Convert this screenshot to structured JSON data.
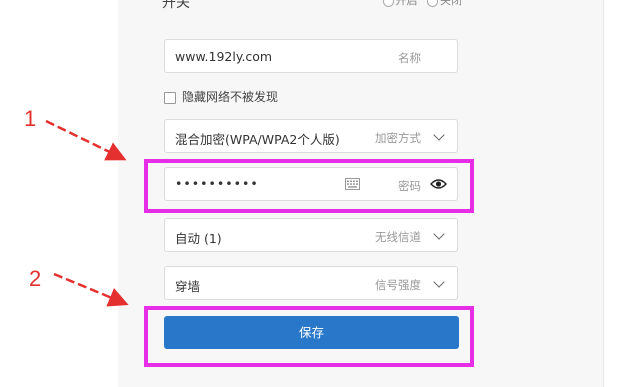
{
  "settings": {
    "switch_title": "开关",
    "switch_on": "开启",
    "switch_off": "关闭",
    "ssid_value": "www.192ly.com",
    "ssid_hint": "名称",
    "hide_label": "隐藏网络不被发现",
    "encryption_value": "混合加密(WPA/WPA2个人版)",
    "encryption_hint": "加密方式",
    "password_value": "••••••••••",
    "password_hint": "密码",
    "channel_value": "自动 (1)",
    "channel_hint": "无线信道",
    "power_value": "穿墙",
    "power_hint": "信号强度",
    "save_label": "保存"
  },
  "annotations": {
    "step1": "1",
    "step2": "2",
    "highlight_color": "#e52ee5",
    "arrow_color": "#e53030"
  },
  "colors": {
    "button": "#2977c9"
  }
}
